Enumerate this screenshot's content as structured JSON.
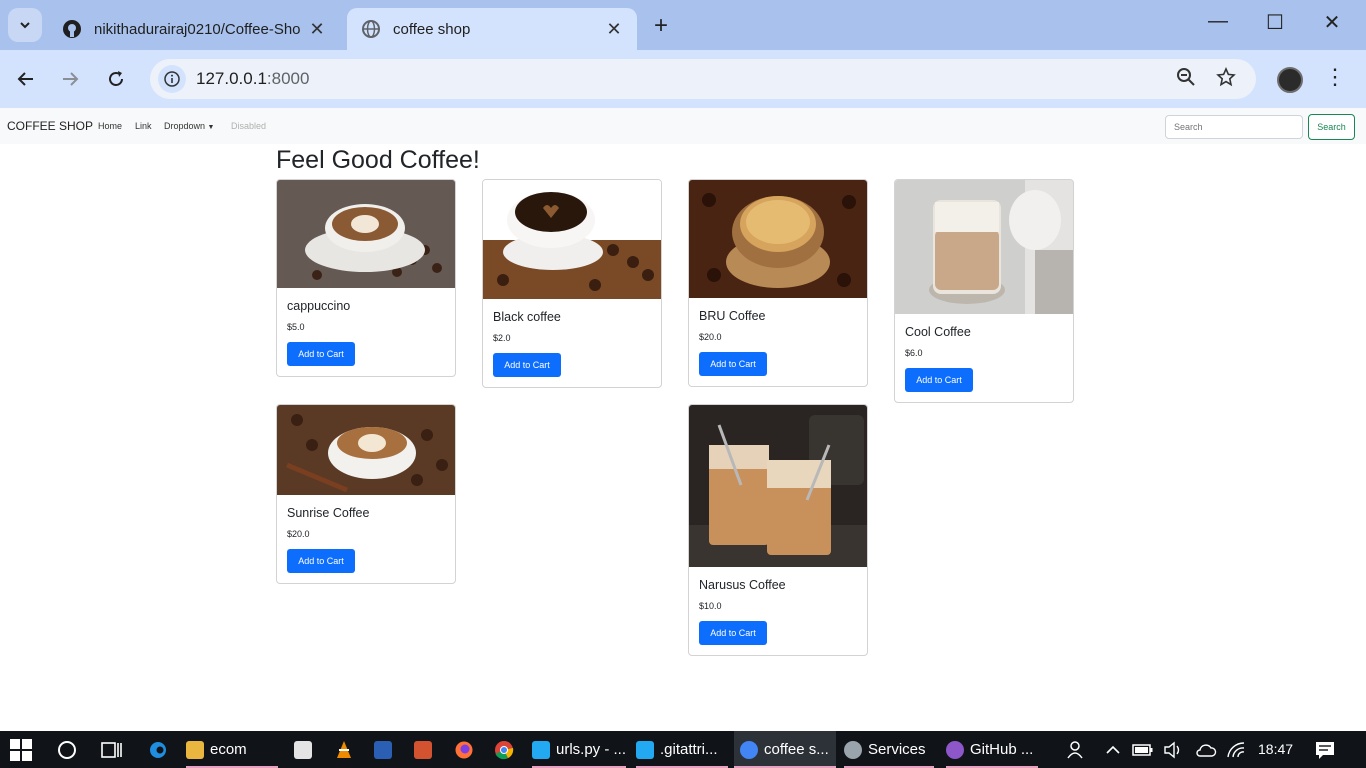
{
  "browser": {
    "tabs": [
      {
        "title": "nikithadurairaj0210/Coffee-Sho",
        "active": false
      },
      {
        "title": "coffee shop",
        "active": true
      }
    ],
    "url_host": "127.0.0.1",
    "url_port": ":8000"
  },
  "navbar": {
    "brand": "COFFEE SHOP",
    "links": [
      "Home",
      "Link",
      "Dropdown",
      "Disabled"
    ],
    "search_placeholder": "Search",
    "search_button": "Search"
  },
  "main": {
    "heading": "Feel Good Coffee!",
    "products": [
      {
        "name": "cappuccino",
        "price": "$5.0",
        "button": "Add to Cart"
      },
      {
        "name": "Black coffee",
        "price": "$2.0",
        "button": "Add to Cart"
      },
      {
        "name": "BRU Coffee",
        "price": "$20.0",
        "button": "Add to Cart"
      },
      {
        "name": "Cool Coffee",
        "price": "$6.0",
        "button": "Add to Cart"
      },
      {
        "name": "Sunrise Coffee",
        "price": "$20.0",
        "button": "Add to Cart"
      },
      {
        "name": "Narusus Coffee",
        "price": "$10.0",
        "button": "Add to Cart"
      }
    ]
  },
  "taskbar": {
    "items": [
      {
        "label": "ecom",
        "icon": "folder-icon"
      },
      {
        "label": "urls.py - ...",
        "icon": "vscode-icon"
      },
      {
        "label": ".gitattri...",
        "icon": "vscode-icon"
      },
      {
        "label": "coffee s...",
        "icon": "chrome-icon"
      },
      {
        "label": "Services",
        "icon": "gear-icon"
      },
      {
        "label": "GitHub ...",
        "icon": "github-icon"
      }
    ],
    "time": "18:47"
  },
  "colors": {
    "tabstrip": "#a8c2ed",
    "toolbar": "#d3e3fd",
    "primary_button": "#0d6efd",
    "success_outline": "#198754",
    "taskbar": "#101418"
  }
}
